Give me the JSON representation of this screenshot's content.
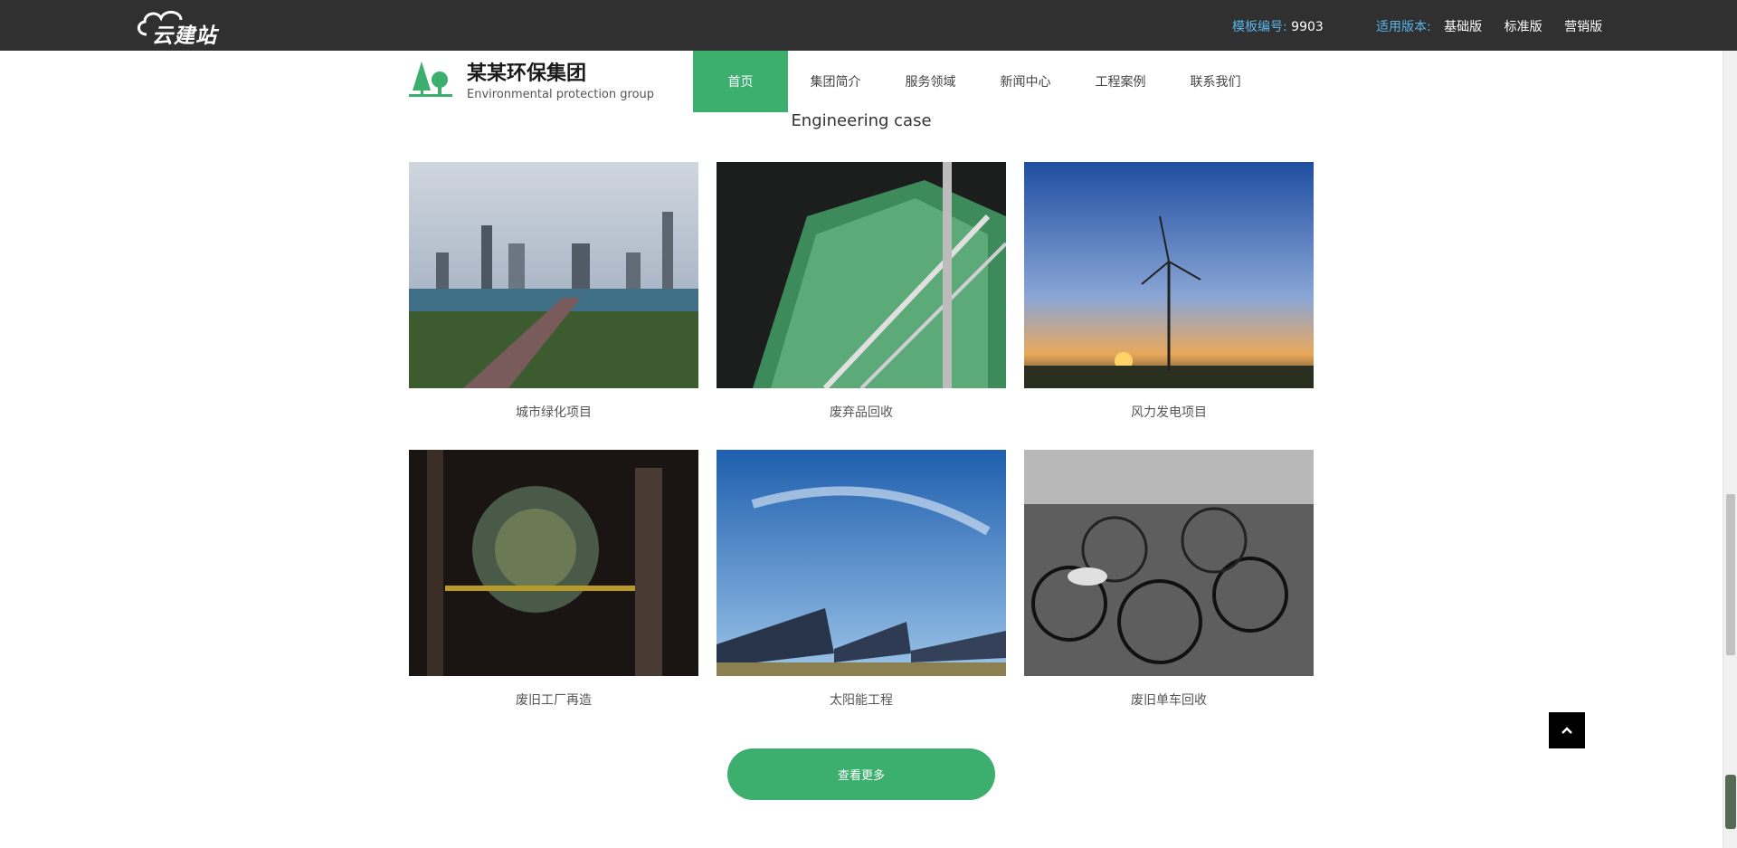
{
  "topbar": {
    "logo_text": "云建站",
    "template_label": "模板编号:",
    "template_value": "9903",
    "version_label": "适用版本:",
    "versions": [
      "基础版",
      "标准版",
      "营销版"
    ]
  },
  "brand": {
    "name": "某某环保集团",
    "subtitle": "Environmental protection group"
  },
  "nav": {
    "items": [
      "首页",
      "集团简介",
      "服务领域",
      "新闻中心",
      "工程案例",
      "联系我们"
    ],
    "active": "首页"
  },
  "section": {
    "title": "Engineering case"
  },
  "cases": [
    {
      "caption": "城市绿化项目",
      "image": "city-skyline"
    },
    {
      "caption": "废弃品回收",
      "image": "bottles-conveyor"
    },
    {
      "caption": "风力发电项目",
      "image": "wind-turbines-sunset"
    },
    {
      "caption": "废旧工厂再造",
      "image": "old-factory-machinery"
    },
    {
      "caption": "太阳能工程",
      "image": "solar-panels"
    },
    {
      "caption": "废旧单车回收",
      "image": "bicycles-bw"
    }
  ],
  "more_button": "查看更多",
  "colors": {
    "accent": "#3caf6f",
    "topbar": "#303030",
    "link_blue": "#5ab4ea"
  }
}
